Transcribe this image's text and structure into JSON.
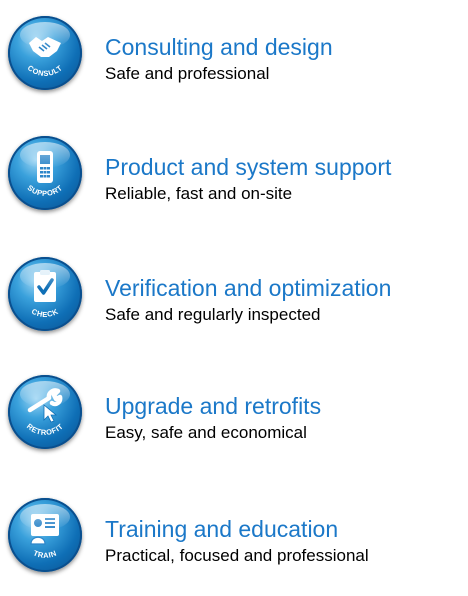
{
  "services": [
    {
      "icon": "handshake-icon",
      "badge_text": "CONSULT",
      "title": "Consulting and design",
      "subtitle": "Safe and professional"
    },
    {
      "icon": "mobile-phone-icon",
      "badge_text": "SUPPORT",
      "title": "Product and system support",
      "subtitle": "Reliable, fast and on-site"
    },
    {
      "icon": "checklist-icon",
      "badge_text": "CHECK",
      "title": "Verification and optimization",
      "subtitle": "Safe and regularly inspected"
    },
    {
      "icon": "wrench-cursor-icon",
      "badge_text": "RETROFIT",
      "title": "Upgrade and retrofits",
      "subtitle": "Easy, safe and economical"
    },
    {
      "icon": "trainer-board-icon",
      "badge_text": "TRAIN",
      "title": "Training and education",
      "subtitle": "Practical, focused and professional"
    }
  ],
  "colors": {
    "title": "#1b78c8",
    "subtitle": "#000000",
    "badge_blue": "#0f6fb6"
  }
}
